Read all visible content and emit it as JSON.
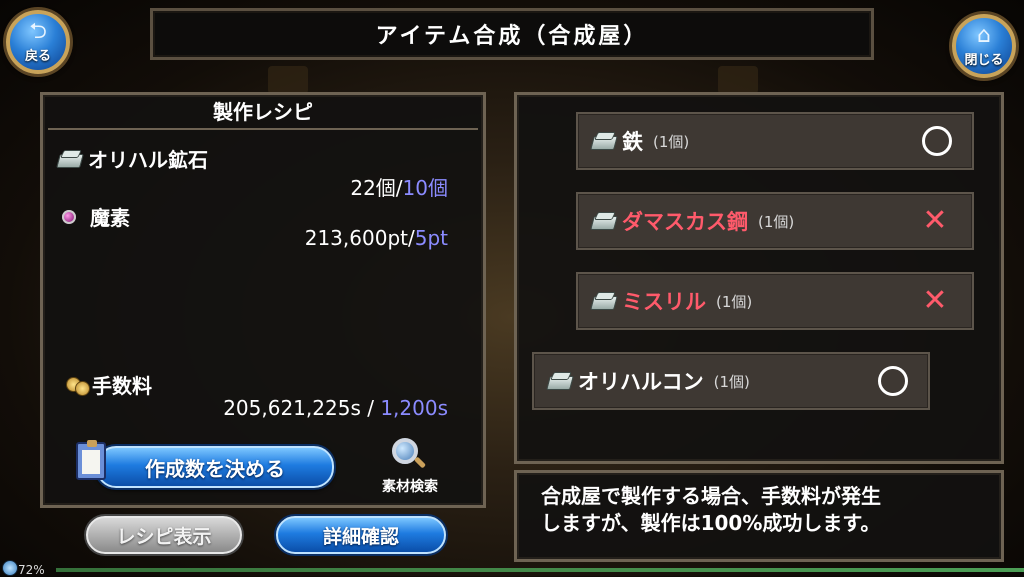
{
  "header": {
    "title": "アイテム合成（合成屋）",
    "back_label": "戻る",
    "close_label": "閉じる"
  },
  "recipe": {
    "title": "製作レシピ",
    "materials": [
      {
        "name": "オリハル鉱石",
        "owned": "22個",
        "separator": "/",
        "required": "10個",
        "icon": "ingot-icon"
      },
      {
        "name": "魔素",
        "owned": "213,600pt",
        "separator": "/",
        "required": "5pt",
        "icon": "orb-icon"
      }
    ],
    "fee": {
      "label": "手数料",
      "owned": "205,621,225s",
      "separator": " / ",
      "required": "1,200s",
      "icon": "coin-icon"
    },
    "make_button": "作成数を決める",
    "search_label": "素材検索"
  },
  "buttons": {
    "recipe_display": "レシピ表示",
    "detail_confirm": "詳細確認"
  },
  "items": [
    {
      "name": "鉄",
      "count": "(1個)",
      "status": "available",
      "color": "#ffffff"
    },
    {
      "name": "ダマスカス鋼",
      "count": "(1個)",
      "status": "unavailable",
      "color": "#ff5a6b"
    },
    {
      "name": "ミスリル",
      "count": "(1個)",
      "status": "unavailable",
      "color": "#ff5a6b"
    },
    {
      "name": "オリハルコン",
      "count": "(1個)",
      "status": "available",
      "color": "#ffffff"
    }
  ],
  "message": {
    "line1": "合成屋で製作する場合、手数料が発生",
    "line2": "しますが、製作は100%成功します。"
  },
  "status": {
    "battery": "72%"
  },
  "colors": {
    "accent_blue": "#1e7be0",
    "required_value": "#8b8bff",
    "unavailable": "#ff5a6b",
    "frame": "#6e6353"
  }
}
